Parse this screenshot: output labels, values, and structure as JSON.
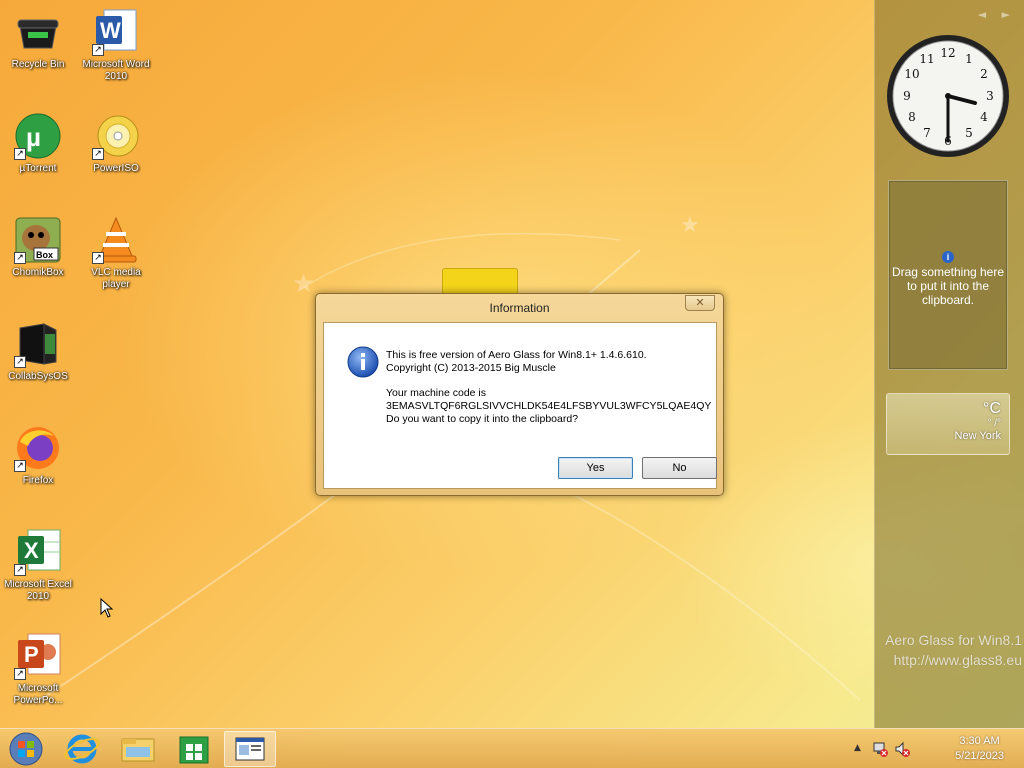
{
  "desktop": {
    "icons": [
      {
        "label": "Recycle Bin"
      },
      {
        "label": "Microsoft Word 2010"
      },
      {
        "label": "µTorrent"
      },
      {
        "label": "PowerISO"
      },
      {
        "label": "ChomikBox"
      },
      {
        "label": "VLC media player"
      },
      {
        "label": "CollabSysOS"
      },
      {
        "label": "Firefox"
      },
      {
        "label": "Microsoft Excel 2010"
      },
      {
        "label": "Microsoft PowerPo..."
      }
    ],
    "watermark": {
      "line1": "Aero Glass for Win8.1",
      "line2": "http://www.glass8.eu"
    }
  },
  "sidebar": {
    "nav": "◄ ►",
    "clipboard_gadget": {
      "text": "Drag something here to put it into the clipboard."
    },
    "weather_gadget": {
      "unit": "°C",
      "range": "° /°",
      "city": "New York"
    }
  },
  "dialog": {
    "title": "Information",
    "close_label": "✕",
    "line1": "This is free version of Aero Glass for Win8.1+ 1.4.6.610.",
    "line2": "Copyright (C) 2013-2015 Big Muscle",
    "line3": "Your machine code is",
    "machine_code": "3EMASVLTQF6RGLSIVVCHLDK54E4LFSBYVUL3WFCY5LQAE4QY",
    "line4": "Do you want to copy it into the clipboard?",
    "yes_label": "Yes",
    "no_label": "No"
  },
  "taskbar": {
    "tray_arrow": "▲",
    "clock_time": "3:30 AM",
    "clock_date": "5/21/2023"
  },
  "colors": {
    "accent": "#f6a93a",
    "dialog_frame": "#e9c27a",
    "info_blue": "#2a64c8"
  }
}
